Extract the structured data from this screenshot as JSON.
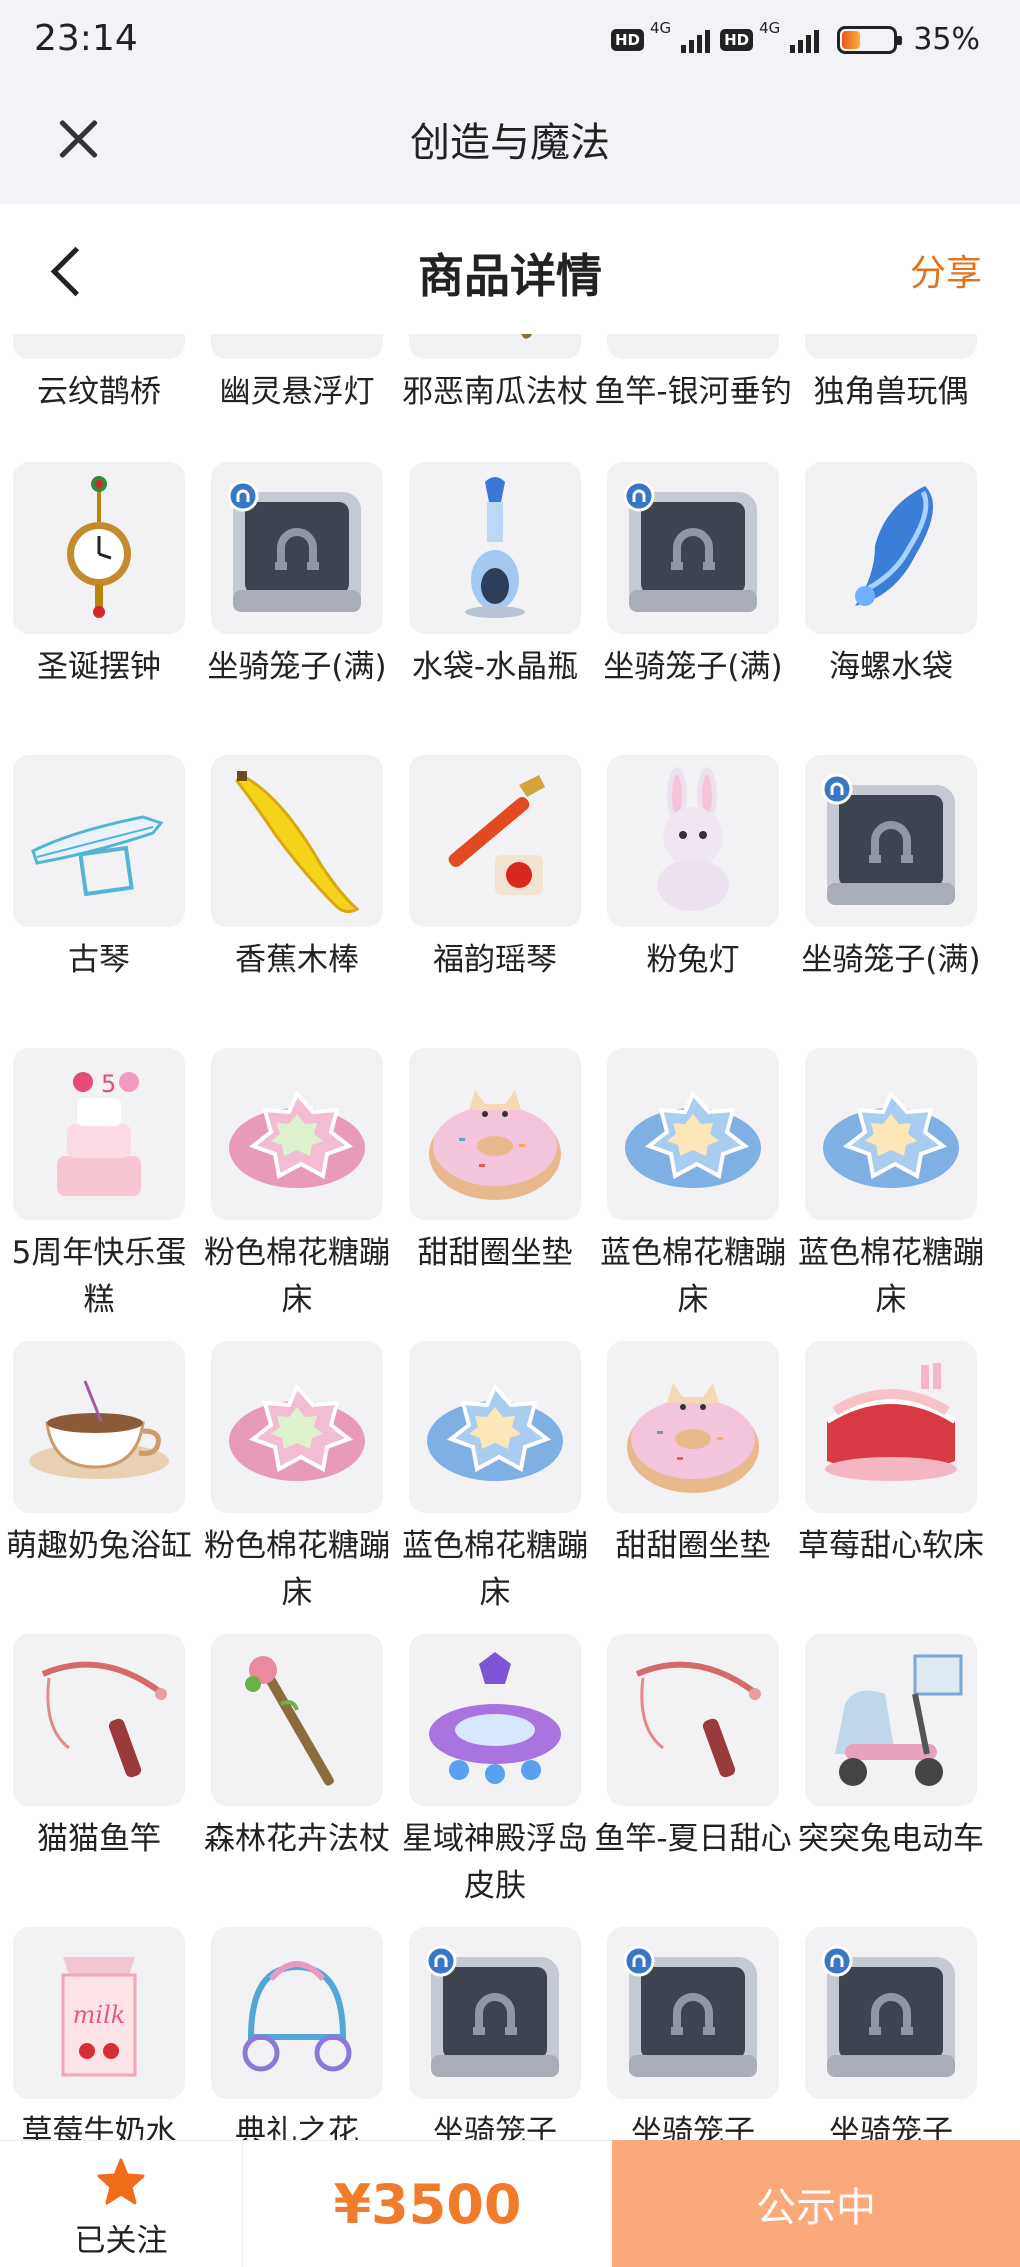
{
  "status_bar": {
    "time": "23:14",
    "hd1": "HD",
    "net1": "4G",
    "hd2": "HD",
    "net2": "4G",
    "battery_text": "35%"
  },
  "app_bar": {
    "title": "创造与魔法"
  },
  "header": {
    "title": "商品详情",
    "share_label": "分享"
  },
  "items": [
    {
      "name": "云纹鹊桥",
      "icon": "bridge"
    },
    {
      "name": "幽灵悬浮灯",
      "icon": "lamp"
    },
    {
      "name": "邪恶南瓜法杖",
      "icon": "staff"
    },
    {
      "name": "鱼竿-银河垂钓",
      "icon": "rod"
    },
    {
      "name": "独角兽玩偶",
      "icon": "doll"
    },
    {
      "name": "圣诞摆钟",
      "icon": "clock"
    },
    {
      "name": "坐骑笼子(满)",
      "icon": "cage"
    },
    {
      "name": "水袋-水晶瓶",
      "icon": "bottle"
    },
    {
      "name": "坐骑笼子(满)",
      "icon": "cage"
    },
    {
      "name": "海螺水袋",
      "icon": "conch"
    },
    {
      "name": "古琴",
      "icon": "guqin"
    },
    {
      "name": "香蕉木棒",
      "icon": "banana"
    },
    {
      "name": "福韵瑶琴",
      "icon": "harp"
    },
    {
      "name": "粉兔灯",
      "icon": "bunny"
    },
    {
      "name": "坐骑笼子(满)",
      "icon": "cage"
    },
    {
      "name": "5周年快乐蛋糕",
      "icon": "cake"
    },
    {
      "name": "粉色棉花糖蹦床",
      "icon": "trampoline-pink"
    },
    {
      "name": "甜甜圈坐垫",
      "icon": "donut"
    },
    {
      "name": "蓝色棉花糖蹦床",
      "icon": "trampoline-blue"
    },
    {
      "name": "蓝色棉花糖蹦床",
      "icon": "trampoline-blue"
    },
    {
      "name": "萌趣奶兔浴缸",
      "icon": "teacup"
    },
    {
      "name": "粉色棉花糖蹦床",
      "icon": "trampoline-pink"
    },
    {
      "name": "蓝色棉花糖蹦床",
      "icon": "trampoline-blue"
    },
    {
      "name": "甜甜圈坐垫",
      "icon": "donut"
    },
    {
      "name": "草莓甜心软床",
      "icon": "bed"
    },
    {
      "name": "猫猫鱼竿",
      "icon": "rod"
    },
    {
      "name": "森林花卉法杖",
      "icon": "staff"
    },
    {
      "name": "星域神殿浮岛皮肤",
      "icon": "island"
    },
    {
      "name": "鱼竿-夏日甜心",
      "icon": "rod"
    },
    {
      "name": "突突兔电动车",
      "icon": "scooter"
    },
    {
      "name": "草莓牛奶水",
      "icon": "milk"
    },
    {
      "name": "典礼之花",
      "icon": "carriage"
    },
    {
      "name": "坐骑笼子",
      "icon": "cage"
    },
    {
      "name": "坐骑笼子",
      "icon": "cage"
    },
    {
      "name": "坐骑笼子",
      "icon": "cage"
    }
  ],
  "bottom_bar": {
    "follow_label": "已关注",
    "price": "¥3500",
    "status_label": "公示中"
  },
  "colors": {
    "accent": "#f07b2a",
    "share": "#e2731c",
    "status_button": "#fba97b",
    "title_bar_bg": "#f1f3f7"
  }
}
